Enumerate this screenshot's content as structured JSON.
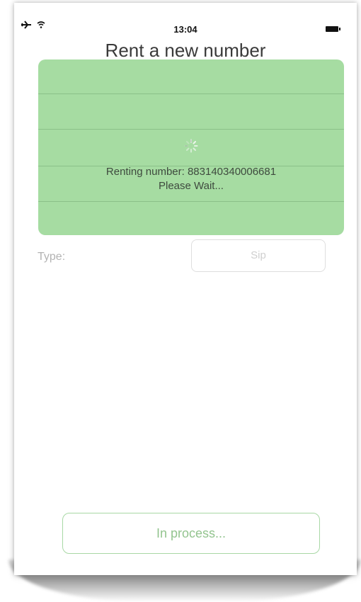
{
  "status_bar": {
    "time": "13:04",
    "left_icons": "✈ ᯤ"
  },
  "nav": {
    "title": "Rent a new number"
  },
  "hud": {
    "message_line1": "Renting number: 883140340006681",
    "message_line2": "Please Wait..."
  },
  "form": {
    "type_label": "Type:",
    "type_value": "Sip"
  },
  "footer": {
    "process_button_label": "In process..."
  },
  "colors": {
    "hud_background": "#a6dca2",
    "accent_green": "#93c48f",
    "title_text": "#3a3a3a"
  },
  "icons": [
    "airplane-mode-icon",
    "wifi-icon",
    "battery-icon",
    "activity-spinner-icon"
  ]
}
